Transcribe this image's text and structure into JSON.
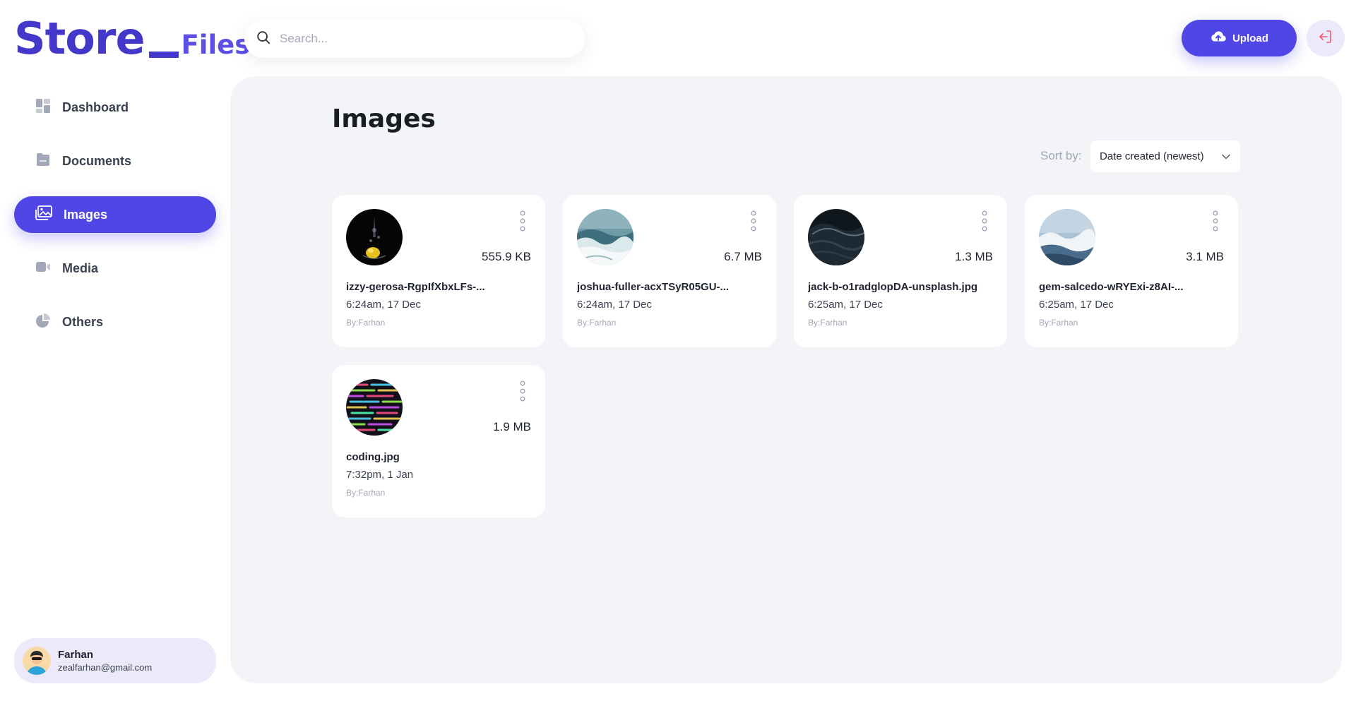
{
  "logo": {
    "store": "Store",
    "files": "Files"
  },
  "search": {
    "placeholder": "Search..."
  },
  "header": {
    "upload_label": "Upload"
  },
  "sidebar": {
    "items": [
      {
        "label": "Dashboard",
        "icon": "dashboard-icon"
      },
      {
        "label": "Documents",
        "icon": "folder-icon"
      },
      {
        "label": "Images",
        "icon": "images-icon",
        "active": true
      },
      {
        "label": "Media",
        "icon": "video-icon"
      },
      {
        "label": "Others",
        "icon": "pie-icon"
      }
    ]
  },
  "user": {
    "name": "Farhan",
    "email": "zealfarhan@gmail.com"
  },
  "main": {
    "title": "Images",
    "sort_label": "Sort by:",
    "sort_value": "Date created (newest)"
  },
  "files": [
    {
      "name": "izzy-gerosa-RgpIfXbxLFs-...",
      "size": "555.9 KB",
      "date": "6:24am, 17 Dec",
      "by": "By:Farhan"
    },
    {
      "name": "joshua-fuller-acxTSyR05GU-...",
      "size": "6.7 MB",
      "date": "6:24am, 17 Dec",
      "by": "By:Farhan"
    },
    {
      "name": "jack-b-o1radglopDA-unsplash.jpg",
      "size": "1.3 MB",
      "date": "6:25am, 17 Dec",
      "by": "By:Farhan"
    },
    {
      "name": "gem-salcedo-wRYExi-z8AI-...",
      "size": "3.1 MB",
      "date": "6:25am, 17 Dec",
      "by": "By:Farhan"
    },
    {
      "name": "coding.jpg",
      "size": "1.9 MB",
      "date": "7:32pm, 1 Jan",
      "by": "By:Farhan"
    }
  ],
  "colors": {
    "accent": "#4f46e5",
    "logo": "#4338ca",
    "main_bg": "#f2f4f8",
    "muted": "#a3a8b8"
  }
}
